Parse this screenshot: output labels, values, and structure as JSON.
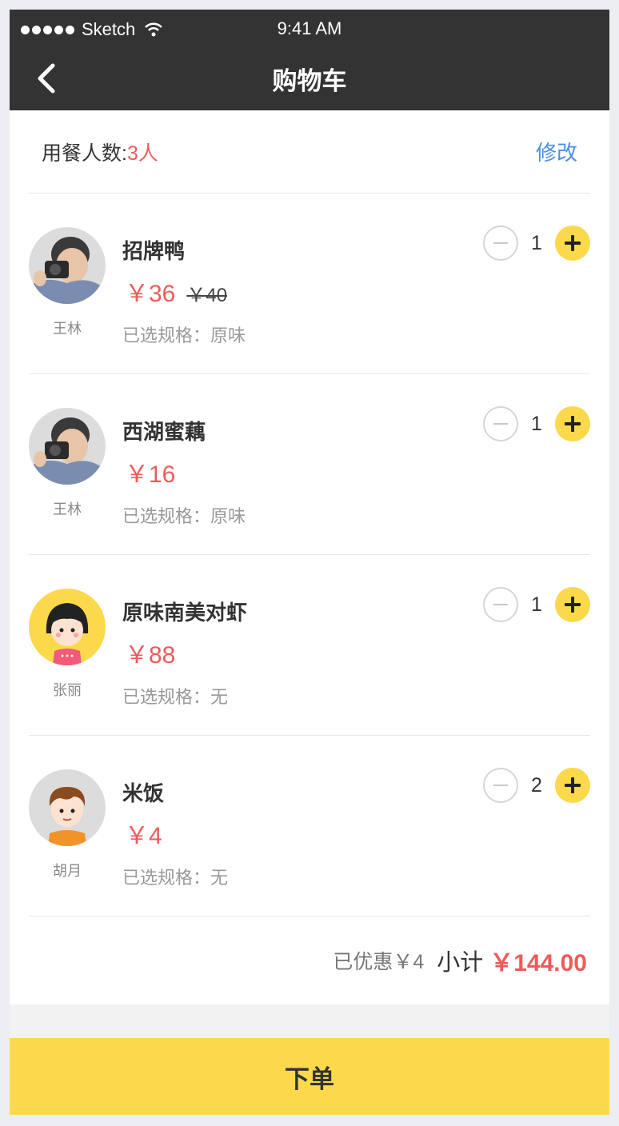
{
  "status_bar": {
    "carrier": "Sketch",
    "time": "9:41 AM"
  },
  "nav": {
    "title": "购物车"
  },
  "diners": {
    "label": "用餐人数:",
    "count": "3人",
    "edit_label": "修改"
  },
  "items": [
    {
      "name": "招牌鸭",
      "price": "￥36",
      "original_price": "￥40",
      "spec": "已选规格：原味",
      "quantity": "1",
      "person": "王林",
      "avatar": "photo-man-camera-icon"
    },
    {
      "name": "西湖蜜藕",
      "price": "￥16",
      "original_price": "",
      "spec": "已选规格：原味",
      "quantity": "1",
      "person": "王林",
      "avatar": "photo-man-camera-icon"
    },
    {
      "name": "原味南美对虾",
      "price": "￥88",
      "original_price": "",
      "spec": "已选规格：无",
      "quantity": "1",
      "person": "张丽",
      "avatar": "cartoon-girl-icon"
    },
    {
      "name": "米饭",
      "price": "￥4",
      "original_price": "",
      "spec": "已选规格：无",
      "quantity": "2",
      "person": "胡月",
      "avatar": "cartoon-boy-icon"
    }
  ],
  "summary": {
    "discount": "已优惠￥4",
    "subtotal_label": "小计",
    "subtotal": "￥144.00"
  },
  "order_button": {
    "label": "下单"
  },
  "colors": {
    "accent_yellow": "#fcd94b",
    "price_red": "#f05a5a",
    "link_blue": "#4a90e2",
    "nav_dark": "#333333"
  }
}
